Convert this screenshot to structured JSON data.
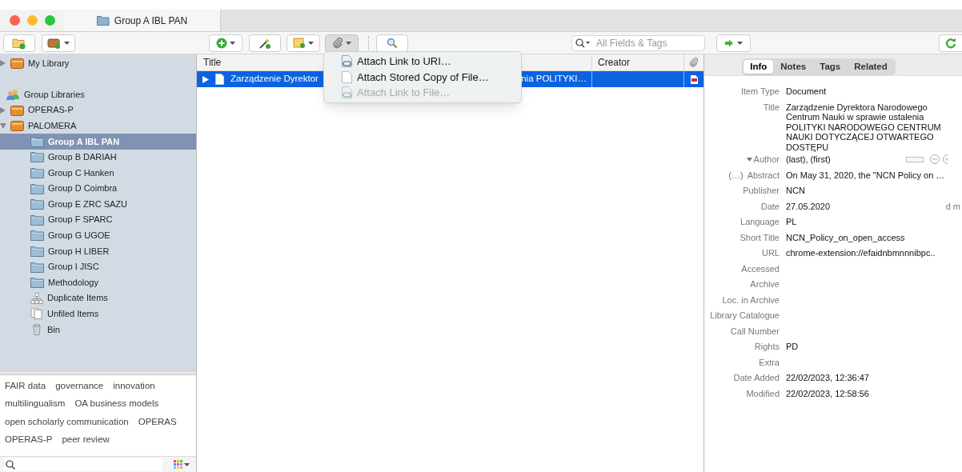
{
  "window": {
    "tab_title": "Group A IBL PAN"
  },
  "toolbar": {
    "search_placeholder": "All Fields & Tags"
  },
  "sidebar": {
    "items": [
      {
        "label": "My Library",
        "kind": "library",
        "expanded": false
      },
      {
        "label": "Group Libraries",
        "kind": "header"
      },
      {
        "label": "OPERAS-P",
        "kind": "library",
        "expanded": false
      },
      {
        "label": "PALOMERA",
        "kind": "library",
        "expanded": true,
        "children": [
          {
            "label": "Group A IBL PAN",
            "kind": "folder",
            "selected": true
          },
          {
            "label": "Group B DARIAH",
            "kind": "folder",
            "selected": false
          },
          {
            "label": "Group C Hanken",
            "kind": "folder",
            "selected": false
          },
          {
            "label": "Group D Coimbra",
            "kind": "folder",
            "selected": false
          },
          {
            "label": "Group E ZRC SAZU",
            "kind": "folder",
            "selected": false
          },
          {
            "label": "Group F SPARC",
            "kind": "folder",
            "selected": false
          },
          {
            "label": "Group G UGOE",
            "kind": "folder",
            "selected": false
          },
          {
            "label": "Group H LIBER",
            "kind": "folder",
            "selected": false
          },
          {
            "label": "Group I JISC",
            "kind": "folder",
            "selected": false
          },
          {
            "label": "Methodology",
            "kind": "folder",
            "selected": false
          },
          {
            "label": "Duplicate Items",
            "kind": "duplicates",
            "selected": false
          },
          {
            "label": "Unfiled Items",
            "kind": "unfiled",
            "selected": false
          },
          {
            "label": "Bin",
            "kind": "bin",
            "selected": false
          }
        ]
      }
    ]
  },
  "tags": [
    [
      "FAIR data",
      "governance",
      "innovation"
    ],
    [
      "multilingualism",
      "OA business models"
    ],
    [
      "open scholarly communication",
      "OPERAS"
    ],
    [
      "OPERAS-P",
      "peer review"
    ]
  ],
  "items_table": {
    "columns": [
      "Title",
      "Creator"
    ],
    "rows": [
      {
        "title_start": "Zarządzenie Dyrektor",
        "title_end": "nia POLITYKI…",
        "selected": true,
        "kind": "pdf",
        "expanded": false
      }
    ]
  },
  "attach_menu": {
    "items": [
      {
        "label": "Attach Link to URI…",
        "kind": "link",
        "disabled": false
      },
      {
        "label": "Attach Stored Copy of File…",
        "kind": "file",
        "disabled": false
      },
      {
        "label": "Attach Link to File…",
        "kind": "link",
        "disabled": true
      }
    ]
  },
  "item_pane": {
    "tabs": [
      {
        "label": "Info",
        "selected": true
      },
      {
        "label": "Notes",
        "selected": false
      },
      {
        "label": "Tags",
        "selected": false
      },
      {
        "label": "Related",
        "selected": false
      }
    ],
    "fields": [
      {
        "label": "Item Type",
        "value": "Document"
      },
      {
        "label": "Title",
        "value": "Zarządzenie Dyrektora Narodowego Centrum Nauki w sprawie ustalenia POLITYKI NARODOWEGO CENTRUM NAUKI DOTYCZĄCEJ OTWARTEGO DOSTĘPU"
      },
      {
        "label": "Author",
        "kind": "creator",
        "value": "(last), (first)"
      },
      {
        "label": "Abstract",
        "prefix": "(…)",
        "value": "On May 31, 2020, the \"NCN Policy on …"
      },
      {
        "label": "Publisher",
        "value": "NCN"
      },
      {
        "label": "Date",
        "value": "27.05.2020",
        "suffix": "d m"
      },
      {
        "label": "Language",
        "value": "PL"
      },
      {
        "label": "Short Title",
        "value": "NCN_Policy_on_open_access"
      },
      {
        "label": "URL",
        "value": "chrome-extension://efaidnbmnnnibpc.."
      },
      {
        "label": "Accessed"
      },
      {
        "label": "Archive"
      },
      {
        "label": "Loc. in Archive"
      },
      {
        "label": "Library Catalogue"
      },
      {
        "label": "Call Number"
      },
      {
        "label": "Rights",
        "value": "PD"
      },
      {
        "label": "Extra"
      },
      {
        "label": "Date Added",
        "value": "22/02/2023, 12:36:47"
      },
      {
        "label": "Modified",
        "value": "22/02/2023, 12:58:56"
      }
    ]
  }
}
